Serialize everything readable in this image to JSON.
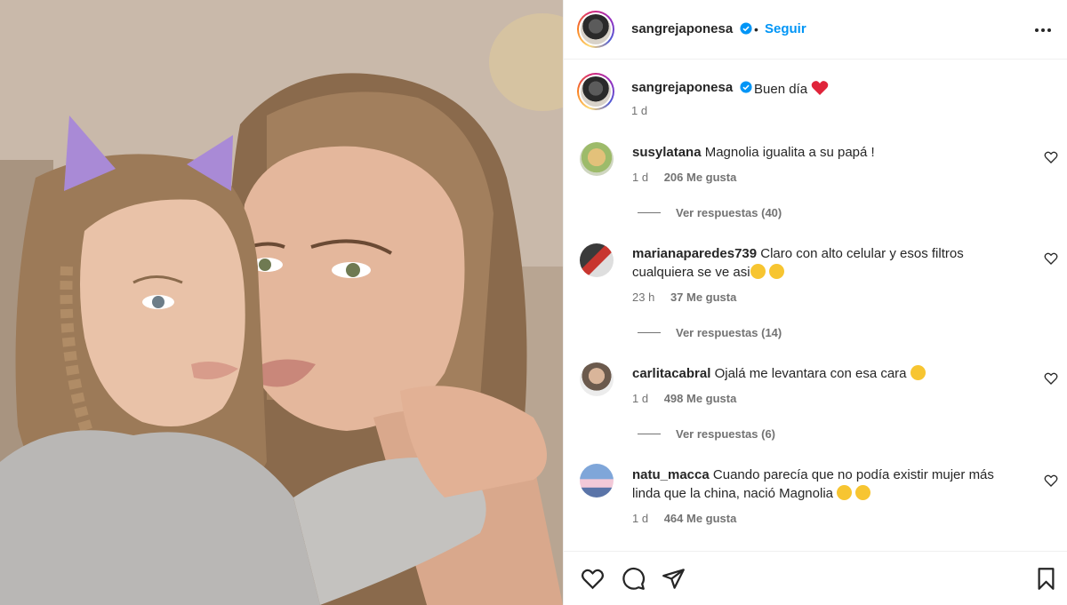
{
  "post": {
    "username": "sangrejaponesa",
    "follow_label": "Seguir",
    "dot": "•",
    "caption": "Buen día",
    "caption_time": "1 d"
  },
  "comments": [
    {
      "username": "susylatana",
      "text": "Magnolia igualita a su papá !",
      "time": "1 d",
      "likes": "206 Me gusta",
      "replies": "Ver respuestas (40)"
    },
    {
      "username": "marianaparedes739",
      "text": "Claro con alto celular y esos filtros cualquiera se ve asi",
      "time": "23 h",
      "likes": "37 Me gusta",
      "replies": "Ver respuestas (14)"
    },
    {
      "username": "carlitacabral",
      "text": "Ojalá me levantara con esa cara",
      "time": "1 d",
      "likes": "498 Me gusta",
      "replies": "Ver respuestas (6)"
    },
    {
      "username": "natu_macca",
      "text": "Cuando parecía que no podía existir mujer más linda que la china, nació Magnolia",
      "time": "1 d",
      "likes": "464 Me gusta"
    }
  ],
  "icons": {
    "verified": "verified-badge-icon",
    "more": "more-options-icon",
    "like": "heart-icon",
    "comment": "comment-icon",
    "share": "share-icon",
    "save": "bookmark-icon"
  },
  "colors": {
    "link": "#0095f6",
    "text": "#262626",
    "muted": "#737373",
    "border": "#efefef"
  }
}
